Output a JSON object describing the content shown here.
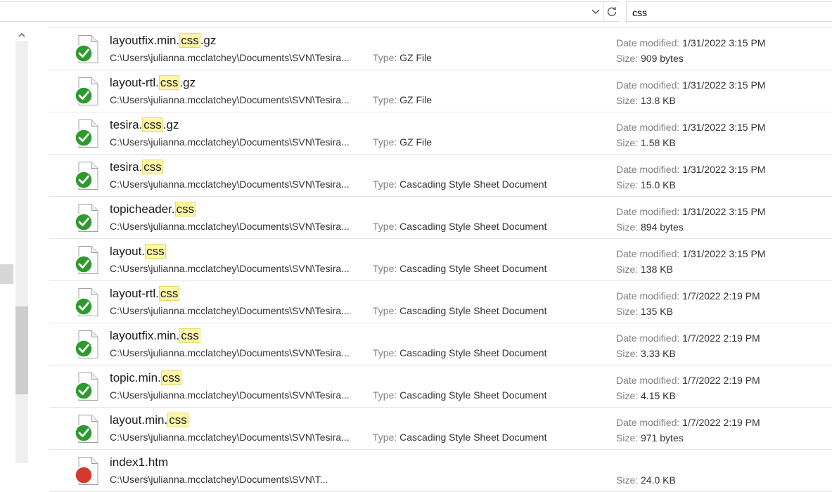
{
  "search": {
    "query": "css"
  },
  "icons": {
    "dropdown": "chevron-down-icon",
    "refresh": "refresh-icon",
    "scroll_up": "chevron-up-icon",
    "synced_overlay": "green-checkmark",
    "error_overlay": "red-circle"
  },
  "colors": {
    "highlight": "#fff7a8",
    "check_green": "#2e9a2e",
    "error_red": "#d33a2c"
  },
  "labels": {
    "type": "Type: ",
    "date_modified": "Date modified: ",
    "size": "Size: "
  },
  "files": [
    {
      "name_pre": "layoutfix.min.",
      "name_hl": "css",
      "name_post": ".gz",
      "path": "C:\\Users\\julianna.mcclatchey\\Documents\\SVN\\Tesira...",
      "type": "GZ File",
      "date": "1/31/2022 3:15 PM",
      "size": "909 bytes",
      "status": "synced"
    },
    {
      "name_pre": "layout-rtl.",
      "name_hl": "css",
      "name_post": ".gz",
      "path": "C:\\Users\\julianna.mcclatchey\\Documents\\SVN\\Tesira...",
      "type": "GZ File",
      "date": "1/31/2022 3:15 PM",
      "size": "13.8 KB",
      "status": "synced"
    },
    {
      "name_pre": "tesira.",
      "name_hl": "css",
      "name_post": ".gz",
      "path": "C:\\Users\\julianna.mcclatchey\\Documents\\SVN\\Tesira...",
      "type": "GZ File",
      "date": "1/31/2022 3:15 PM",
      "size": "1.58 KB",
      "status": "synced"
    },
    {
      "name_pre": "tesira.",
      "name_hl": "css",
      "name_post": "",
      "path": "C:\\Users\\julianna.mcclatchey\\Documents\\SVN\\Tesira...",
      "type": "Cascading Style Sheet Document",
      "date": "1/31/2022 3:15 PM",
      "size": "15.0 KB",
      "status": "synced"
    },
    {
      "name_pre": "topicheader.",
      "name_hl": "css",
      "name_post": "",
      "path": "C:\\Users\\julianna.mcclatchey\\Documents\\SVN\\Tesira...",
      "type": "Cascading Style Sheet Document",
      "date": "1/31/2022 3:15 PM",
      "size": "894 bytes",
      "status": "synced"
    },
    {
      "name_pre": "layout.",
      "name_hl": "css",
      "name_post": "",
      "path": "C:\\Users\\julianna.mcclatchey\\Documents\\SVN\\Tesira...",
      "type": "Cascading Style Sheet Document",
      "date": "1/31/2022 3:15 PM",
      "size": "138 KB",
      "status": "synced"
    },
    {
      "name_pre": "layout-rtl.",
      "name_hl": "css",
      "name_post": "",
      "path": "C:\\Users\\julianna.mcclatchey\\Documents\\SVN\\Tesira...",
      "type": "Cascading Style Sheet Document",
      "date": "1/7/2022 2:19 PM",
      "size": "135 KB",
      "status": "synced"
    },
    {
      "name_pre": "layoutfix.min.",
      "name_hl": "css",
      "name_post": "",
      "path": "C:\\Users\\julianna.mcclatchey\\Documents\\SVN\\Tesira...",
      "type": "Cascading Style Sheet Document",
      "date": "1/7/2022 2:19 PM",
      "size": "3.33 KB",
      "status": "synced"
    },
    {
      "name_pre": "topic.min.",
      "name_hl": "css",
      "name_post": "",
      "path": "C:\\Users\\julianna.mcclatchey\\Documents\\SVN\\Tesira...",
      "type": "Cascading Style Sheet Document",
      "date": "1/7/2022 2:19 PM",
      "size": "4.15 KB",
      "status": "synced"
    },
    {
      "name_pre": "layout.min.",
      "name_hl": "css",
      "name_post": "",
      "path": "C:\\Users\\julianna.mcclatchey\\Documents\\SVN\\Tesira...",
      "type": "Cascading Style Sheet Document",
      "date": "1/7/2022 2:19 PM",
      "size": "971 bytes",
      "status": "synced"
    },
    {
      "name_pre": "index1.htm",
      "name_hl": "",
      "name_post": "",
      "path": "C:\\Users\\julianna.mcclatchey\\Documents\\SVN\\T...",
      "type": "",
      "date": "",
      "size": "24.0 KB",
      "status": "error"
    }
  ]
}
